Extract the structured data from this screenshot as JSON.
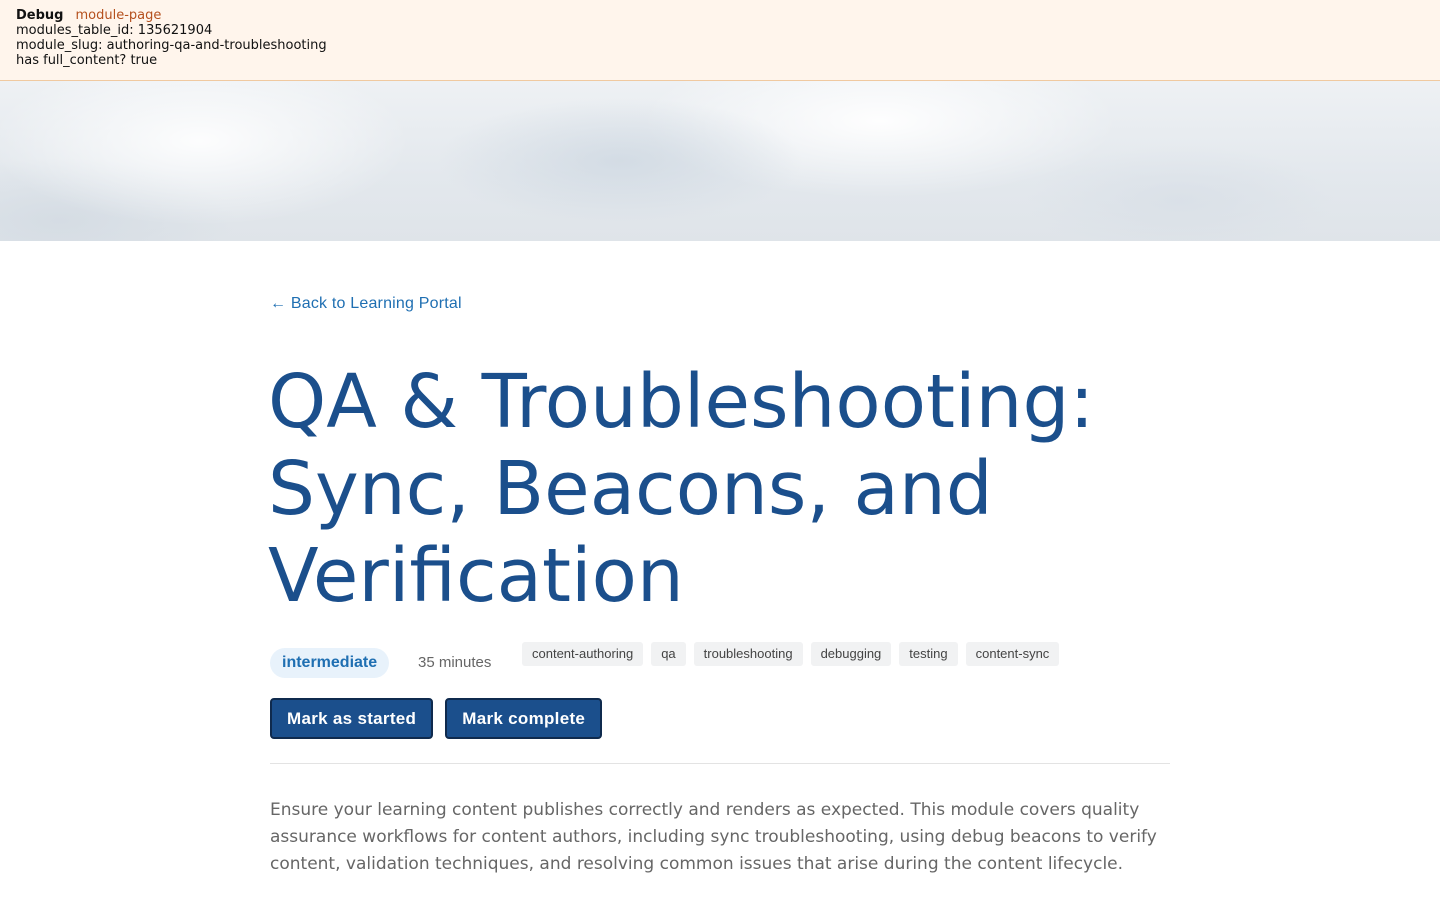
{
  "debug": {
    "title": "Debug",
    "page_type": "module-page",
    "lines": [
      "modules_table_id: 135621904",
      "module_slug: authoring-qa-and-troubleshooting",
      "has full_content? true"
    ]
  },
  "nav": {
    "back_label": "← Back to Learning Portal"
  },
  "module": {
    "title": "QA & Troubleshooting: Sync, Beacons, and Verification",
    "level": "intermediate",
    "duration": "35 minutes",
    "tags": [
      "content-authoring",
      "qa",
      "troubleshooting",
      "debugging",
      "testing",
      "content-sync"
    ],
    "description": "Ensure your learning content publishes correctly and renders as expected. This module covers quality assurance workflows for content authors, including sync troubleshooting, using debug beacons to verify content, validation techniques, and resolving common issues that arise during the content lifecycle."
  },
  "actions": {
    "start_label": "Mark as started",
    "complete_label": "Mark complete"
  },
  "colors": {
    "brand": "#1b4f8c",
    "link": "#1f6fb2",
    "debug_bg": "#fff5ec"
  }
}
